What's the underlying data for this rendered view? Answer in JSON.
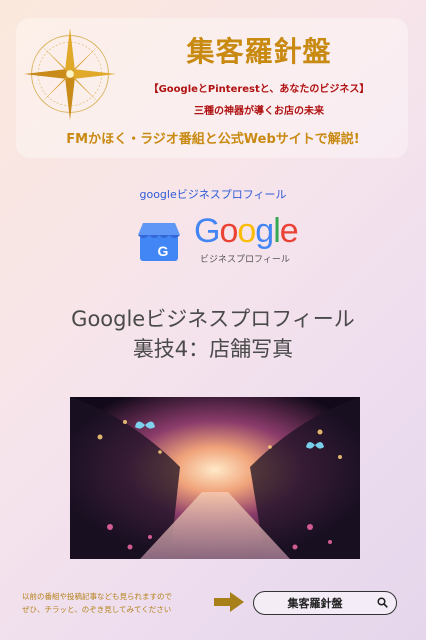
{
  "header": {
    "title": "集客羅針盤",
    "subtitle": "【GoogleとPinterestと、あなたのビジネス】",
    "tagline": "三種の神器が導くお店の未来",
    "radio_line": "FMかほく・ラジオ番組と公式Webサイトで解説!"
  },
  "gbp": {
    "label": "googleビジネスプロフィール",
    "logo_letters": [
      "G",
      "o",
      "o",
      "g",
      "l",
      "e"
    ],
    "logo_colors": [
      "#4285F4",
      "#EA4335",
      "#FBBC05",
      "#4285F4",
      "#34A853",
      "#EA4335"
    ],
    "logo_sub": "ビジネスプロフィール",
    "store_icon_letter": "G"
  },
  "main": {
    "title_line1": "Googleビジネスプロフィール",
    "title_line2": "裏技4：店舗写真"
  },
  "footer": {
    "cta_line1": "以前の番組や投稿記事なども見られますので",
    "cta_line2": "ぜひ、チラッと、のぞき見してみてください",
    "search_text": "集客羅針盤"
  },
  "colors": {
    "brand_gold": "#c98a12",
    "accent_red": "#b01212",
    "link_blue": "#2e5bd8"
  }
}
